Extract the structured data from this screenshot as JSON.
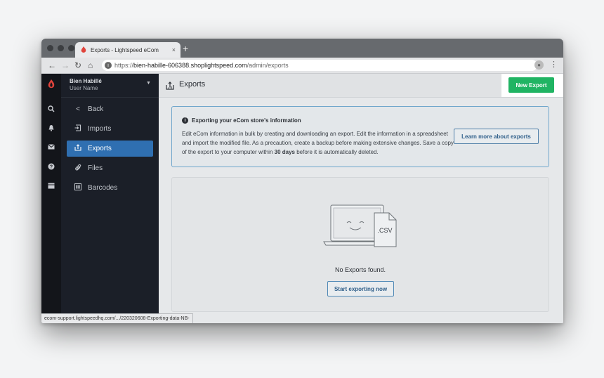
{
  "browser": {
    "tab_title": "Exports - Lightspeed eCom",
    "tab_close": "×",
    "new_tab": "+",
    "url_scheme": "https://",
    "url_host": "bien-habille-606388.shoplightspeed.com",
    "url_path": "/admin/exports",
    "status_url": "ecom-support.lightspeedhq.com/.../220320608-Exporting-data-NB-"
  },
  "sidebar": {
    "store_name": "Bien Habillé",
    "user_name": "User Name",
    "items": [
      {
        "label": "Back",
        "icon": "chevron-left-icon",
        "glyph": "‹"
      },
      {
        "label": "Imports",
        "icon": "import-icon",
        "glyph": "⇥"
      },
      {
        "label": "Exports",
        "icon": "export-icon",
        "glyph": "⇪"
      },
      {
        "label": "Files",
        "icon": "paperclip-icon",
        "glyph": "⌕"
      },
      {
        "label": "Barcodes",
        "icon": "barcode-icon",
        "glyph": "▤"
      }
    ],
    "active_item": "Exports"
  },
  "header": {
    "title": "Exports",
    "new_export_label": "New Export"
  },
  "info": {
    "heading": "Exporting your eCom store's information",
    "body_before": "Edit eCom information in bulk by creating and downloading an export. Edit the information in a spreadsheet and import the modified file. As a precaution, create a backup before making extensive changes. Save a copy of the export to your computer within ",
    "body_bold": "30 days",
    "body_after": " before it is automatically deleted.",
    "button_label": "Learn more about exports"
  },
  "empty": {
    "file_label": ".CSV",
    "message": "No Exports found.",
    "button_label": "Start exporting now"
  },
  "colors": {
    "accent_green": "#20b463",
    "active_blue": "#2f6fb1",
    "sidebar_bg": "#1b1f28",
    "brand_red": "#e0433b"
  }
}
